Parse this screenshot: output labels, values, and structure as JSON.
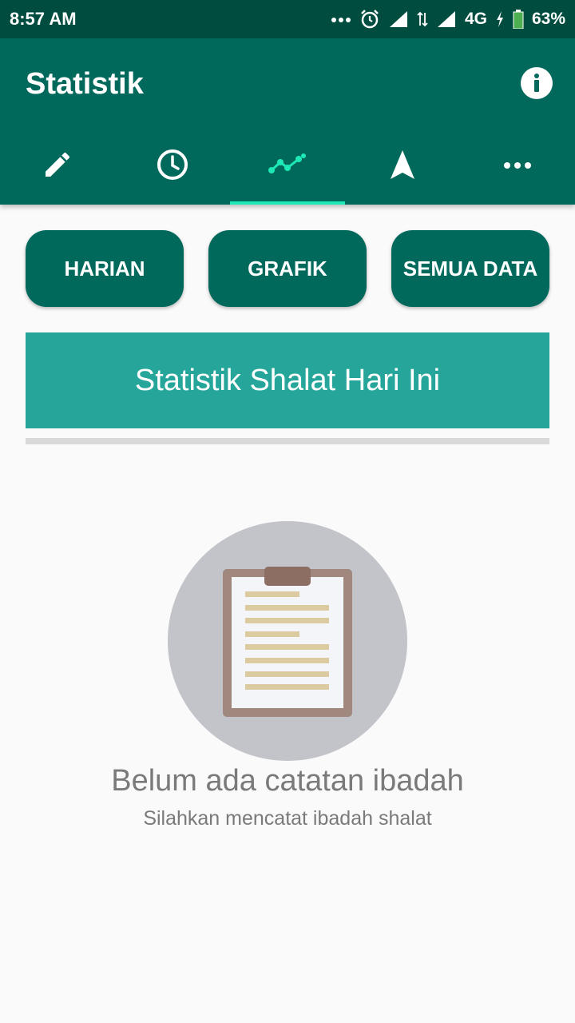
{
  "status_bar": {
    "time": "8:57 AM",
    "network": "4G",
    "battery": "63%",
    "icons": [
      "more-dots-icon",
      "alarm-icon",
      "signal-icon",
      "data-arrows-icon",
      "signal-icon",
      "charging-icon",
      "battery-icon"
    ]
  },
  "app_bar": {
    "title": "Statistik",
    "action_icon": "info-icon"
  },
  "tabs": [
    {
      "icon": "pencil-icon",
      "active": false
    },
    {
      "icon": "clock-icon",
      "active": false
    },
    {
      "icon": "trend-chart-icon",
      "active": true
    },
    {
      "icon": "navigation-arrow-icon",
      "active": false
    },
    {
      "icon": "more-icon",
      "active": false
    }
  ],
  "buttons": {
    "daily": "HARIAN",
    "chart": "GRAFIK",
    "all_data": "SEMUA DATA"
  },
  "banner": {
    "title": "Statistik Shalat Hari Ini"
  },
  "empty_state": {
    "icon": "clipboard-icon",
    "title": "Belum ada catatan ibadah",
    "subtitle": "Silahkan mencatat ibadah shalat"
  },
  "colors": {
    "status_bar": "#004d40",
    "app_bar": "#00695c",
    "tab_indicator": "#1de9b6",
    "banner": "#26a69a",
    "background": "#fafafa"
  }
}
